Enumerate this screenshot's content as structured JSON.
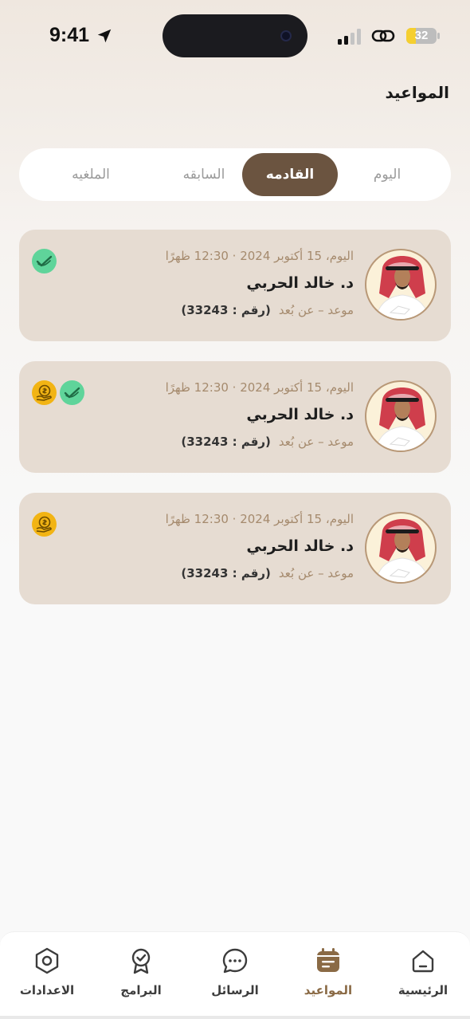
{
  "status_bar": {
    "time": "9:41",
    "battery_level": "32",
    "battery_fraction": 0.32
  },
  "header": {
    "title": "المواعيد"
  },
  "tabs": [
    {
      "label": "اليوم",
      "active": false
    },
    {
      "label": "القادمه",
      "active": true
    },
    {
      "label": "السابقه",
      "active": false
    },
    {
      "label": "الملغيه",
      "active": false
    }
  ],
  "appointments": [
    {
      "datetime": "اليوم، 15 أكتوبر 2024 · 12:30 ظهرًا",
      "doctor": "د. خالد الحربي",
      "type": "موعد – عن بُعد",
      "number": "(رقم : 33243)",
      "badges": [
        "paid-check-icon"
      ]
    },
    {
      "datetime": "اليوم، 15 أكتوبر 2024 · 12:30 ظهرًا",
      "doctor": "د. خالد الحربي",
      "type": "موعد – عن بُعد",
      "number": "(رقم : 33243)",
      "badges": [
        "paid-check-icon",
        "coin-hand-icon"
      ]
    },
    {
      "datetime": "اليوم، 15 أكتوبر 2024 · 12:30 ظهرًا",
      "doctor": "د. خالد الحربي",
      "type": "موعد – عن بُعد",
      "number": "(رقم : 33243)",
      "badges": [
        "coin-hand-icon"
      ]
    }
  ],
  "bottom_nav": [
    {
      "label": "الرئيسية",
      "icon": "home-icon",
      "active": false
    },
    {
      "label": "المواعيد",
      "icon": "calendar-icon",
      "active": true
    },
    {
      "label": "الرسائل",
      "icon": "chat-icon",
      "active": false
    },
    {
      "label": "البرامج",
      "icon": "badge-check-icon",
      "active": false
    },
    {
      "label": "الاعدادات",
      "icon": "settings-icon",
      "active": false
    }
  ],
  "colors": {
    "accent": "#6b5440",
    "card_bg": "#e6dcd2",
    "meta_text": "#a58a6d",
    "paid_green": "#5fd49a",
    "coin_yellow": "#f2b414",
    "nav_active": "#8a6a45"
  }
}
